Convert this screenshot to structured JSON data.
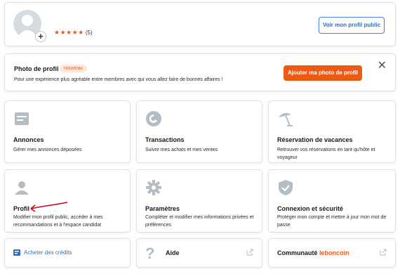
{
  "profile": {
    "stars": "★★★★★",
    "rating_count": "(5)",
    "public_profile_button": "Voir mon profil public",
    "add_photo_symbol": "+"
  },
  "photo_banner": {
    "title": "Photo de profil",
    "badge": "nouveau",
    "description": "Pour une expérience plus agréable entre membres avec qui vous allez faire de bonnes affaires !",
    "button": "Ajouter ma photo de profil",
    "close_symbol": "✕"
  },
  "tiles": [
    {
      "title": "Annonces",
      "description": "Gérer mes annonces déposées"
    },
    {
      "title": "Transactions",
      "description": "Suivre mes achats et mes ventes"
    },
    {
      "title": "Réservation de vacances",
      "description": "Retrouver vos réservations en tant qu'hôte et voyageur"
    },
    {
      "title": "Profil",
      "description": "Modifier mon profil public, accéder à mes recommandations et à l'espace candidat"
    },
    {
      "title": "Paramètres",
      "description": "Compléter et modifier mes informations privées et préférences"
    },
    {
      "title": "Connexion et sécurité",
      "description": "Protéger mon compte et mettre à jour mon mot de passe"
    }
  ],
  "bottom": {
    "credits_link": "Acheter des crédits",
    "aide_symbol": "?",
    "aide_label": "Aide",
    "communaute_label": "Communauté",
    "communaute_brand": "leboncoin"
  },
  "colors": {
    "accent_orange": "#ec5a13",
    "link_blue": "#2d6fc1",
    "icon_gray": "#b4bcc4",
    "annotation_red": "#d0021b"
  },
  "icons": [
    "avatar-icon",
    "plus-icon",
    "close-icon",
    "annonces-icon",
    "transactions-icon",
    "vacation-icon",
    "profile-icon",
    "gear-icon",
    "shield-icon",
    "credits-icon",
    "help-icon",
    "external-link-icon"
  ]
}
